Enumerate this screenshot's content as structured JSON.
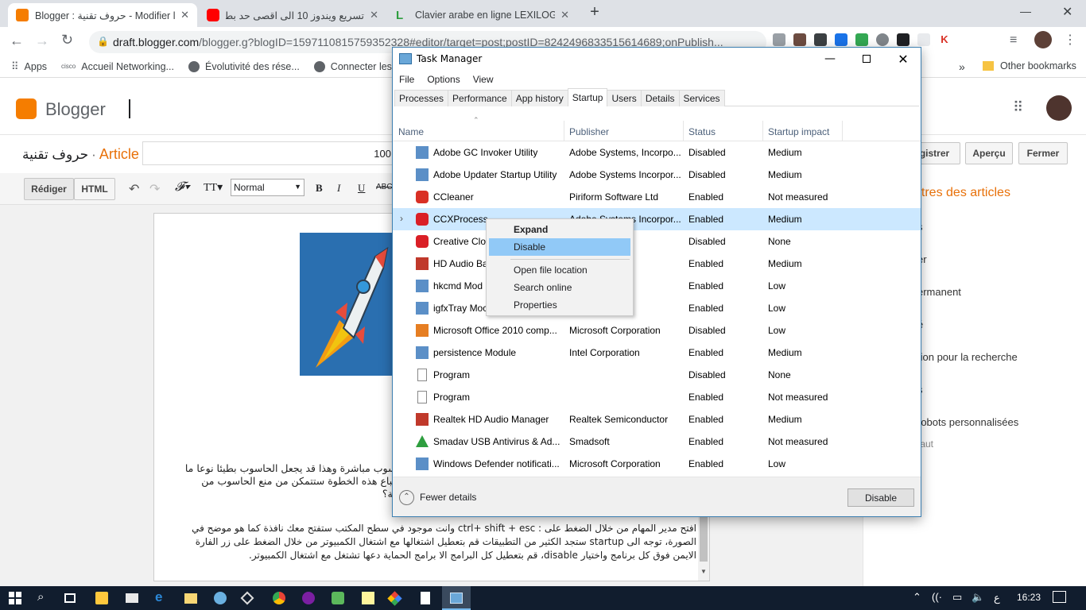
{
  "browser": {
    "tabs": [
      {
        "title": "Blogger : حروف تقنية - Modifier l'a",
        "color": "#f57d00"
      },
      {
        "title": "تسريع ويندوز 10 الى اقصى حد بطر",
        "color": "#ff0000"
      },
      {
        "title": "Clavier arabe en ligne LEXILOGOS",
        "color": "#2e9e3f"
      }
    ],
    "new_tab": "+",
    "url_domain": "draft.blogger.com",
    "url_path": "/blogger.g?blogID=1597110815759352328#editor/target=post;postID=8242496833515614689;onPublish...",
    "bookmarks": [
      "Apps",
      "Accueil Networking...",
      "Évolutivité des rése...",
      "Connecter les r"
    ],
    "overflow": "»",
    "other_bookmarks": "Other bookmarks"
  },
  "blogger": {
    "logo_text": "Blogger",
    "blog_name": "حروف تقنية",
    "separator": "·",
    "post_label": "Article",
    "title_value": "100",
    "buttons": {
      "save": "gistrer",
      "preview": "Aperçu",
      "close": "Fermer"
    },
    "modes": {
      "compose": "Rédiger",
      "html": "HTML"
    },
    "font_size": "Normal",
    "sidebar_title": "ètres des articles",
    "sidebar_items": [
      "s",
      "er",
      "ermanent",
      "é",
      "tion pour la recherche",
      "s",
      "robots personnalisées",
      "faut"
    ],
    "body_lines": [
      "حاسوب مباشرة وهذا قد يجعل الحاسوب بطيئا نوعا ما",
      "د اتباع هذه الخطوة ستتمكن من منع الحاسوب من",
      "ريقة؟",
      "افتح مدير المهام من خلال الضغط على : ctrl+ shift + esc وانت موجود في سطح المكتب ستفتح معك نافذة كما هو موضح في",
      "الصورة، توجه الى startup ستجد الكثير من التطبيقات قم بتعطيل اشتغالها مع اشتغال الكمبيوتر من خلال الضغط على زر الفارة",
      "الايمن فوق كل برنامج واختيار disable، قم بتعطيل كل البرامج الا برامج الحماية دعها تشتغل مع اشتغال الكمبيوتر."
    ]
  },
  "taskmanager": {
    "title": "Task Manager",
    "menu": [
      "File",
      "Options",
      "View"
    ],
    "tabs": [
      "Processes",
      "Performance",
      "App history",
      "Startup",
      "Users",
      "Details",
      "Services"
    ],
    "active_tab": "Startup",
    "columns": [
      "Name",
      "Publisher",
      "Status",
      "Startup impact"
    ],
    "rows": [
      {
        "name": "Adobe GC Invoker Utility",
        "publisher": "Adobe Systems, Incorpo...",
        "status": "Disabled",
        "impact": "Medium",
        "icon": "app-window-icon"
      },
      {
        "name": "Adobe Updater Startup Utility",
        "publisher": "Adobe Systems Incorpor...",
        "status": "Disabled",
        "impact": "Medium",
        "icon": "app-window-icon"
      },
      {
        "name": "CCleaner",
        "publisher": "Piriform Software Ltd",
        "status": "Enabled",
        "impact": "Not measured",
        "icon": "ccleaner-icon"
      },
      {
        "name": "CCXProcess",
        "publisher": "Adobe Systems Incorpor...",
        "status": "Enabled",
        "impact": "Medium",
        "icon": "adobe-cc-icon"
      },
      {
        "name": "Creative Clou",
        "publisher": "",
        "status": "Disabled",
        "impact": "None",
        "icon": "adobe-cc-icon"
      },
      {
        "name": "HD Audio Ba",
        "publisher": "nductor",
        "status": "Enabled",
        "impact": "Medium",
        "icon": "speaker-icon"
      },
      {
        "name": "hkcmd Mod",
        "publisher": "on",
        "status": "Enabled",
        "impact": "Low",
        "icon": "app-window-icon"
      },
      {
        "name": "igfxTray Moc",
        "publisher": "on",
        "status": "Enabled",
        "impact": "Low",
        "icon": "app-window-icon"
      },
      {
        "name": "Microsoft Office 2010 comp...",
        "publisher": "Microsoft Corporation",
        "status": "Disabled",
        "impact": "Low",
        "icon": "office-icon"
      },
      {
        "name": "persistence Module",
        "publisher": "Intel Corporation",
        "status": "Enabled",
        "impact": "Medium",
        "icon": "app-window-icon"
      },
      {
        "name": "Program",
        "publisher": "",
        "status": "Disabled",
        "impact": "None",
        "icon": "file-icon"
      },
      {
        "name": "Program",
        "publisher": "",
        "status": "Enabled",
        "impact": "Not measured",
        "icon": "file-icon"
      },
      {
        "name": "Realtek HD Audio Manager",
        "publisher": "Realtek Semiconductor",
        "status": "Enabled",
        "impact": "Medium",
        "icon": "speaker-icon"
      },
      {
        "name": "Smadav USB Antivirus & Ad...",
        "publisher": "Smadsoft",
        "status": "Enabled",
        "impact": "Not measured",
        "icon": "smadav-icon"
      },
      {
        "name": "Windows Defender notificati...",
        "publisher": "Microsoft Corporation",
        "status": "Enabled",
        "impact": "Low",
        "icon": "app-window-icon"
      }
    ],
    "selected_row": "CCXProcess",
    "context_menu": [
      "Expand",
      "Disable",
      "Open file location",
      "Search online",
      "Properties"
    ],
    "fewer_details": "Fewer details",
    "disable_button": "Disable"
  },
  "taskbar": {
    "language": "ع",
    "time": "16:23"
  }
}
